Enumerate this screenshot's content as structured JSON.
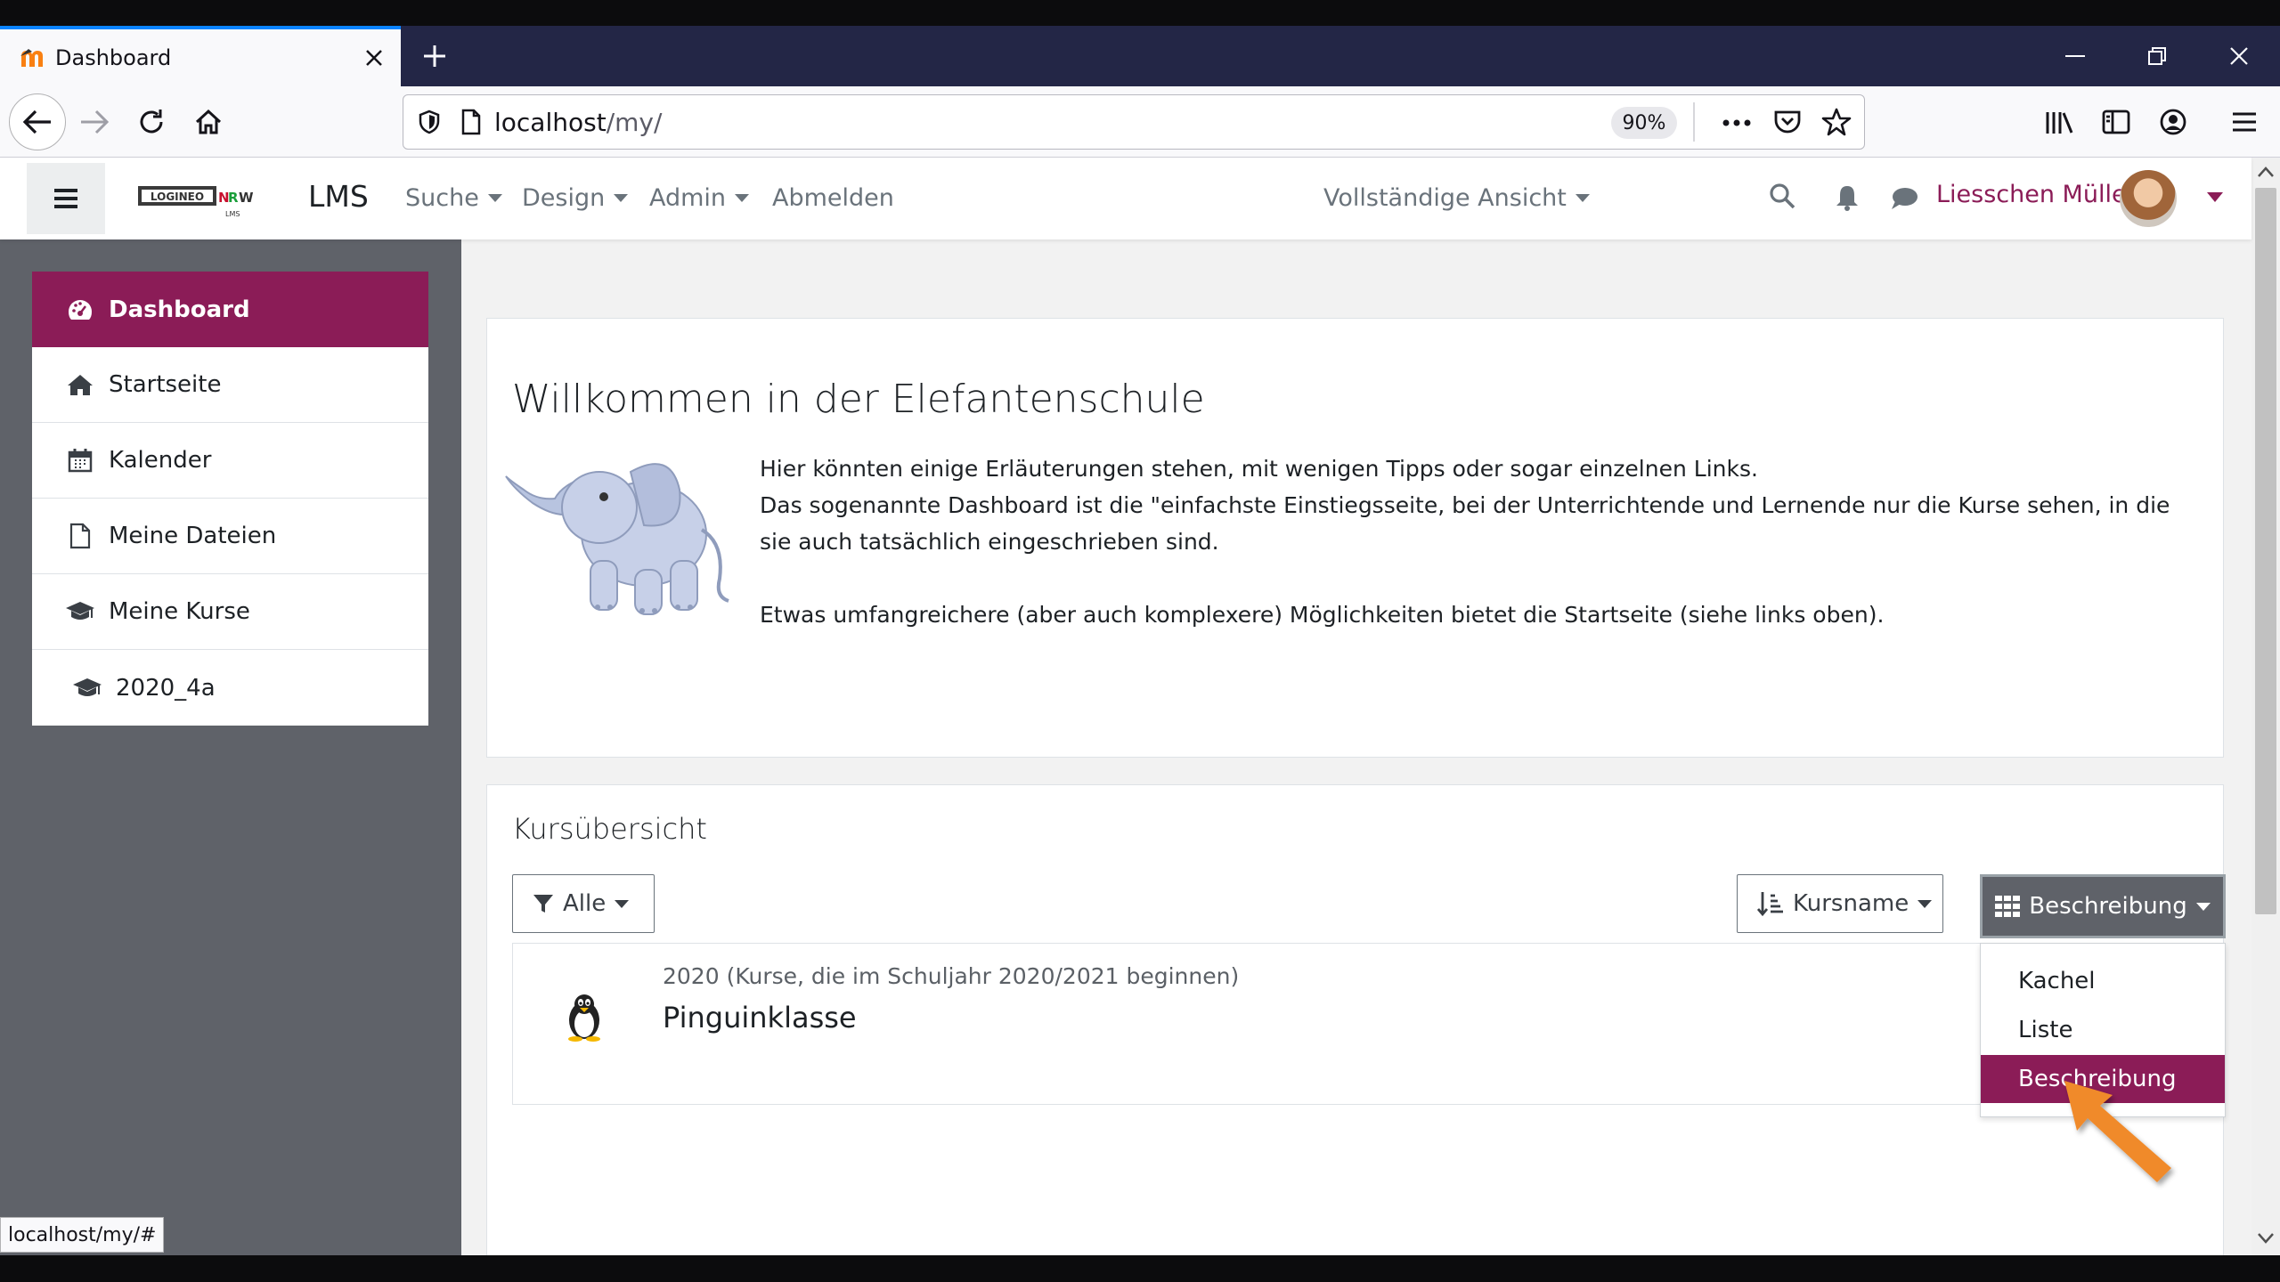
{
  "browser": {
    "tab_title": "Dashboard",
    "url_host": "localhost",
    "url_path": "/my/",
    "zoom": "90%",
    "status_url": "localhost/my/#"
  },
  "topnav": {
    "brand": "LMS",
    "logo_text": "LOGINEO NRW LMS",
    "menu": [
      "Suche",
      "Design",
      "Admin",
      "Abmelden"
    ],
    "view_mode": "Vollständige Ansicht",
    "user_name": "Liesschen Müller"
  },
  "sidebar": {
    "items": [
      {
        "label": "Dashboard",
        "icon": "dashboard-icon",
        "active": true
      },
      {
        "label": "Startseite",
        "icon": "home-icon"
      },
      {
        "label": "Kalender",
        "icon": "calendar-icon"
      },
      {
        "label": "Meine Dateien",
        "icon": "file-icon"
      },
      {
        "label": "Meine Kurse",
        "icon": "graduation-cap-icon"
      },
      {
        "label": "2020_4a",
        "icon": "graduation-cap-icon"
      }
    ]
  },
  "welcome": {
    "title": "Willkommen in der Elefantenschule",
    "line1": "Hier könnten einige Erläuterungen stehen, mit wenigen Tipps oder sogar einzelnen Links.",
    "line2": "Das sogenannte Dashboard ist die \"einfachste Einstiegsseite, bei der Unterrichtende und Lernende nur die Kurse sehen, in die sie auch tatsächlich eingeschrieben sind.",
    "line3": "Etwas umfangreichere (aber auch komplexere) Möglichkeiten bietet die Startseite (siehe links oben)."
  },
  "courses": {
    "title": "Kursübersicht",
    "filter_label": "Alle",
    "sort_label": "Kursname",
    "view_label": "Beschreibung",
    "view_options": [
      "Kachel",
      "Liste",
      "Beschreibung"
    ],
    "selected_view": "Beschreibung",
    "items": [
      {
        "category": "2020 (Kurse, die im Schuljahr 2020/2021 beginnen)",
        "name": "Pinguinklasse"
      }
    ]
  },
  "colors": {
    "accent": "#8b1c57",
    "sidebar_bg": "#5f6269",
    "tab_strip": "#232646"
  }
}
